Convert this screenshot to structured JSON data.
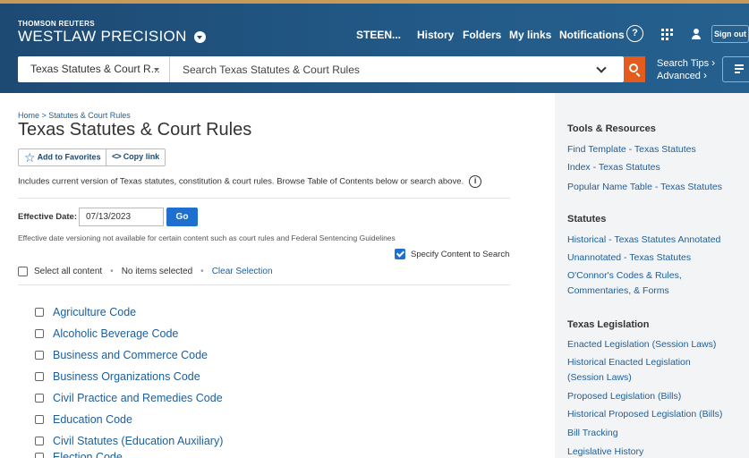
{
  "header": {
    "brand_top": "THOMSON REUTERS",
    "brand_main": "WESTLAW PRECISION",
    "nav": {
      "client": "STEEN...",
      "history": "History",
      "folders": "Folders",
      "mylinks": "My links",
      "notifications": "Notifications",
      "help": "?",
      "signout": "Sign out"
    },
    "search": {
      "jurisdiction": "Texas Statutes & Court R...",
      "placeholder": "Search Texas Statutes & Court Rules",
      "tips": "Search Tips",
      "advanced": "Advanced"
    }
  },
  "main": {
    "breadcrumb": "Home > Statutes & Court Rules",
    "title": "Texas Statutes & Court Rules",
    "add_favorites": "Add to Favorites",
    "copy_link": "Copy link",
    "description": "Includes current version of Texas statutes, constitution & court rules. Browse Table of Contents below or search above.",
    "info_glyph": "i",
    "effective_label": "Effective Date:",
    "effective_value": "07/13/2023",
    "go": "Go",
    "effective_note": "Effective date versioning not available for certain content such as court rules and Federal Sentencing Guidelines",
    "specify": "Specify Content to Search",
    "select_all": "Select all content",
    "no_items": "No items selected",
    "clear": "Clear Selection",
    "codes": [
      "Agriculture Code",
      "Alcoholic Beverage Code",
      "Business and Commerce Code",
      "Business Organizations Code",
      "Civil Practice and Remedies Code",
      "Education Code",
      "Civil Statutes (Education Auxiliary)",
      "Election Code"
    ]
  },
  "sidebar": {
    "sections": [
      {
        "heading": "Tools & Resources",
        "links": [
          "Find Template - Texas Statutes",
          "Index - Texas Statutes",
          "Popular Name Table - Texas Statutes"
        ]
      },
      {
        "heading": "Statutes",
        "links": [
          "Historical - Texas Statutes Annotated",
          "Unannotated - Texas Statutes",
          "O'Connor's Codes & Rules,",
          "Commentaries, & Forms"
        ]
      },
      {
        "heading": "Texas Legislation",
        "links": [
          "Enacted Legislation (Session Laws)",
          "Historical Enacted Legislation",
          "(Session Laws)",
          "Proposed Legislation (Bills)",
          "Historical Proposed Legislation (Bills)",
          "Bill Tracking",
          "Legislative History"
        ]
      }
    ]
  },
  "colors": {
    "header_bg": "#1d4a73",
    "accent_orange": "#e45c1d",
    "link_blue": "#1d5e9a",
    "button_blue": "#1f6fd1",
    "sidebar_bg": "#f2f4f6"
  }
}
